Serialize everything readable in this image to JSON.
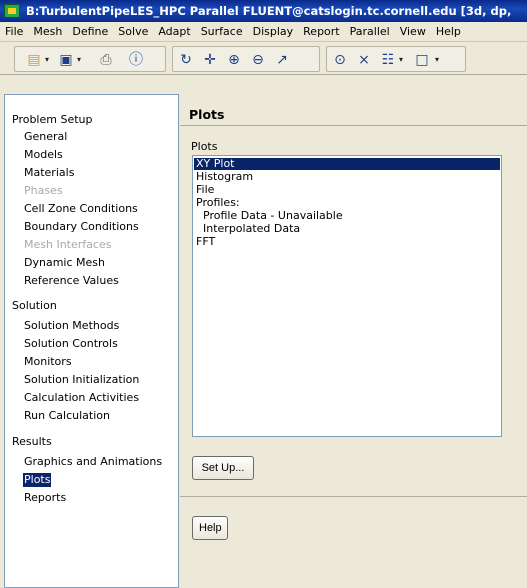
{
  "window": {
    "title": "B:TurbulentPipeLES_HPC Parallel FLUENT@catslogin.tc.cornell.edu  [3d, dp,"
  },
  "menubar": {
    "items": [
      "File",
      "Mesh",
      "Define",
      "Solve",
      "Adapt",
      "Surface",
      "Display",
      "Report",
      "Parallel",
      "View",
      "Help"
    ]
  },
  "toolbar": {
    "icons": [
      "open-icon",
      "save-icon",
      "print-icon",
      "help-icon",
      "rotate-icon",
      "pan-icon",
      "zoom-in-icon",
      "zoom-out-icon",
      "probe-icon",
      "zoom-fit-icon",
      "axes-icon",
      "layout-icon",
      "window-icon"
    ]
  },
  "tree": {
    "sections": [
      {
        "label": "Problem Setup",
        "items": [
          {
            "label": "General",
            "disabled": false
          },
          {
            "label": "Models",
            "disabled": false
          },
          {
            "label": "Materials",
            "disabled": false
          },
          {
            "label": "Phases",
            "disabled": true
          },
          {
            "label": "Cell Zone Conditions",
            "disabled": false
          },
          {
            "label": "Boundary Conditions",
            "disabled": false
          },
          {
            "label": "Mesh Interfaces",
            "disabled": true
          },
          {
            "label": "Dynamic Mesh",
            "disabled": false
          },
          {
            "label": "Reference Values",
            "disabled": false
          }
        ]
      },
      {
        "label": "Solution",
        "items": [
          {
            "label": "Solution Methods",
            "disabled": false
          },
          {
            "label": "Solution Controls",
            "disabled": false
          },
          {
            "label": "Monitors",
            "disabled": false
          },
          {
            "label": "Solution Initialization",
            "disabled": false
          },
          {
            "label": "Calculation Activities",
            "disabled": false
          },
          {
            "label": "Run Calculation",
            "disabled": false
          }
        ]
      },
      {
        "label": "Results",
        "items": [
          {
            "label": "Graphics and Animations",
            "disabled": false
          },
          {
            "label": "Plots",
            "disabled": false,
            "selected": true
          },
          {
            "label": "Reports",
            "disabled": false
          }
        ]
      }
    ]
  },
  "panel": {
    "title": "Plots",
    "list_label": "Plots",
    "list_items": [
      {
        "label": "XY Plot",
        "selected": true,
        "indent": false
      },
      {
        "label": "Histogram",
        "selected": false,
        "indent": false
      },
      {
        "label": "File",
        "selected": false,
        "indent": false
      },
      {
        "label": "Profiles:",
        "selected": false,
        "indent": false
      },
      {
        "label": "Profile Data - Unavailable",
        "selected": false,
        "indent": true
      },
      {
        "label": "Interpolated Data",
        "selected": false,
        "indent": true
      },
      {
        "label": "FFT",
        "selected": false,
        "indent": false
      }
    ],
    "setup_button": "Set Up...",
    "help_button": "Help"
  },
  "colors": {
    "titlebar": "#0a2a8a",
    "selection": "#0a246a",
    "face": "#ece9d8",
    "disabled_text": "#a9a9a9"
  }
}
